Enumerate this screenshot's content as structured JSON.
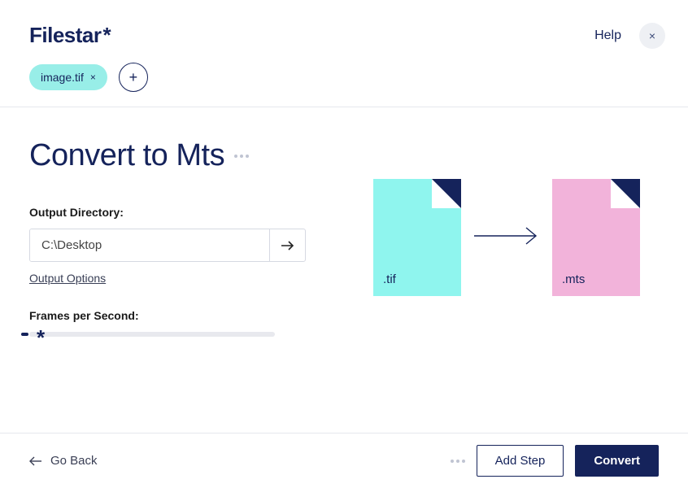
{
  "brand": {
    "name": "Filestar",
    "suffix": "*"
  },
  "header": {
    "help_label": "Help",
    "close_glyph": "×",
    "file_chip": {
      "name": "image.tif",
      "remove_glyph": "×"
    },
    "add_glyph": "+"
  },
  "page": {
    "title": "Convert to Mts"
  },
  "output": {
    "label": "Output Directory:",
    "path": "C:\\Desktop",
    "options_link": "Output Options"
  },
  "fps": {
    "label": "Frames per Second:",
    "thumb_glyph": "*"
  },
  "diagram": {
    "src_ext": ".tif",
    "dst_ext": ".mts"
  },
  "footer": {
    "go_back": "Go Back",
    "add_step": "Add Step",
    "convert": "Convert"
  }
}
